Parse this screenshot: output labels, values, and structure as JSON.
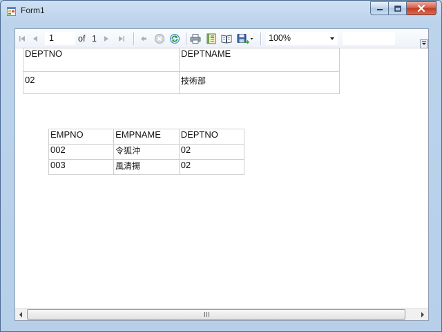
{
  "window": {
    "title": "Form1",
    "icons": {
      "app": "form-app-icon",
      "minimize": "minimize-icon",
      "maximize": "maximize-icon",
      "close": "close-icon"
    }
  },
  "toolbar": {
    "current_page": "1",
    "of_label": "of",
    "total_pages": "1",
    "zoom": "100%",
    "search_value": "",
    "icons": [
      "first-page-icon",
      "previous-page-icon",
      "next-page-icon",
      "last-page-icon",
      "back-icon",
      "stop-icon",
      "refresh-icon",
      "print-icon",
      "print-layout-icon",
      "page-setup-icon",
      "export-icon"
    ]
  },
  "report": {
    "department": {
      "headers": [
        "DEPTNO",
        "DEPTNAME"
      ],
      "rows": [
        [
          "02",
          "技術部"
        ]
      ]
    },
    "employees": {
      "headers": [
        "EMPNO",
        "EMPNAME",
        "DEPTNO"
      ],
      "rows": [
        [
          "002",
          "令狐沖",
          "02"
        ],
        [
          "003",
          "風清揚",
          "02"
        ]
      ]
    }
  },
  "colors": {
    "frame": "#b9d1ea",
    "close_button": "#c43a22",
    "cell_border": "#cfcfcf"
  }
}
